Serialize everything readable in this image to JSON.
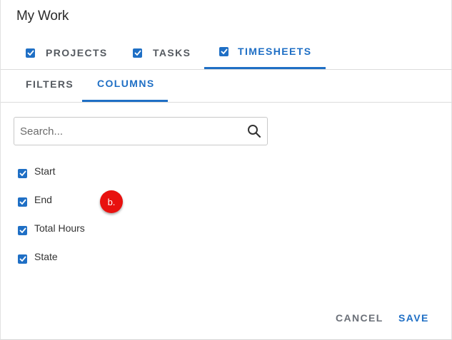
{
  "dialog": {
    "title": "My Work"
  },
  "top_tabs": [
    {
      "label": "PROJECTS",
      "checked": true,
      "active": false
    },
    {
      "label": "TASKS",
      "checked": true,
      "active": false
    },
    {
      "label": "TIMESHEETS",
      "checked": true,
      "active": true
    }
  ],
  "sub_tabs": [
    {
      "label": "FILTERS",
      "active": false
    },
    {
      "label": "COLUMNS",
      "active": true
    }
  ],
  "search": {
    "placeholder": "Search...",
    "value": "",
    "icon": "search-icon"
  },
  "columns": [
    {
      "label": "Start",
      "checked": true
    },
    {
      "label": "End",
      "checked": true
    },
    {
      "label": "Total Hours",
      "checked": true
    },
    {
      "label": "State",
      "checked": true
    }
  ],
  "marker": {
    "label": "b."
  },
  "footer": {
    "cancel_label": "CANCEL",
    "save_label": "SAVE"
  },
  "colors": {
    "accent": "#1f6fc5",
    "marker": "#e8110f",
    "text_muted": "#555a60"
  }
}
